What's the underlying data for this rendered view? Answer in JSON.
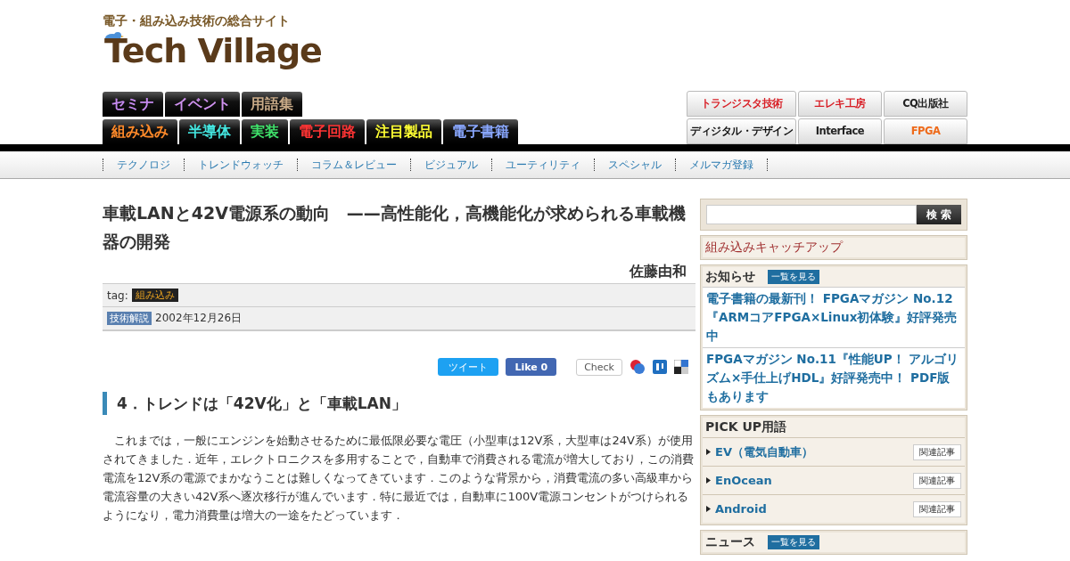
{
  "header": {
    "tagline": "電子・組み込み技術の総合サイト",
    "logo": "Tech Village"
  },
  "nav_rows": [
    [
      {
        "label": "セミナ",
        "color": "#c58af0"
      },
      {
        "label": "イベント",
        "color": "#d092f0"
      },
      {
        "label": "用語集",
        "color": "#c9ab88"
      }
    ],
    [
      {
        "label": "組み込み",
        "color": "#ff8a2a"
      },
      {
        "label": "半導体",
        "color": "#44e6e0"
      },
      {
        "label": "実装",
        "color": "#3fe06a"
      },
      {
        "label": "電子回路",
        "color": "#ff3434"
      },
      {
        "label": "注目製品",
        "color": "#ffff33"
      },
      {
        "label": "電子書籍",
        "color": "#8aa8ff"
      }
    ]
  ],
  "publishers": [
    {
      "label": "トランジスタ技術",
      "color": "#d81f26"
    },
    {
      "label": "エレキ工房",
      "color": "#d81f26"
    },
    {
      "label": "CQ出版社",
      "color": "#222222"
    },
    {
      "label": "ディジタル・デザイン",
      "color": "#111111"
    },
    {
      "label": "Interface",
      "color": "#222222"
    },
    {
      "label": "FPGA",
      "color": "#ee6a1a"
    }
  ],
  "subnav": [
    "テクノロジ",
    "トレンドウォッチ",
    "コラム＆レビュー",
    "ビジュアル",
    "ユーティリティ",
    "スペシャル",
    "メルマガ登録"
  ],
  "article": {
    "title": "車載LANと42V電源系の動向　——高性能化，高機能化が求められる車載機器の開発",
    "author": "佐藤由和",
    "tag_label": "tag:",
    "tag": "組み込み",
    "category": "技術解説",
    "date": "2002年12月26日",
    "share": {
      "tweet": "ツイート",
      "like": "Like",
      "like_count": "0",
      "check": "Check"
    },
    "section_heading": "4．トレンドは「42V化」と「車載LAN」",
    "paragraph": "　これまでは，一般にエンジンを始動させるために最低限必要な電圧（小型車は12V系，大型車は24V系）が使用されてきました．近年，エレクトロニクスを多用することで，自動車で消費される電流が増大しており，この消費電流を12V系の電源でまかなうことは難しくなってきています．このような背景から，消費電流の多い高級車から電流容量の大きい42V系へ逐次移行が進んでいます．特に最近では，自動車に100V電源コンセントがつけられるようになり，電力消費量は増大の一途をたどっています．"
  },
  "sidebar": {
    "search_button": "検 索",
    "catchup": "組み込みキャッチアップ",
    "notices": {
      "title": "お知らせ",
      "more": "一覧を見る",
      "items": [
        "電子書籍の最新刊！ FPGAマガジン No.12『ARMコアFPGA×Linux初体験』好評発売中",
        "FPGAマガジン No.11『性能UP！ アルゴリズム×手仕上げHDL』好評発売中！ PDF版もあります"
      ]
    },
    "pickup": {
      "title": "PICK UP用語",
      "items": [
        {
          "term": "EV（電気自動車）",
          "link": "関連記事"
        },
        {
          "term": "EnOcean",
          "link": "関連記事"
        },
        {
          "term": "Android",
          "link": "関連記事"
        }
      ]
    },
    "news": {
      "title": "ニュース",
      "more": "一覧を見る"
    }
  }
}
